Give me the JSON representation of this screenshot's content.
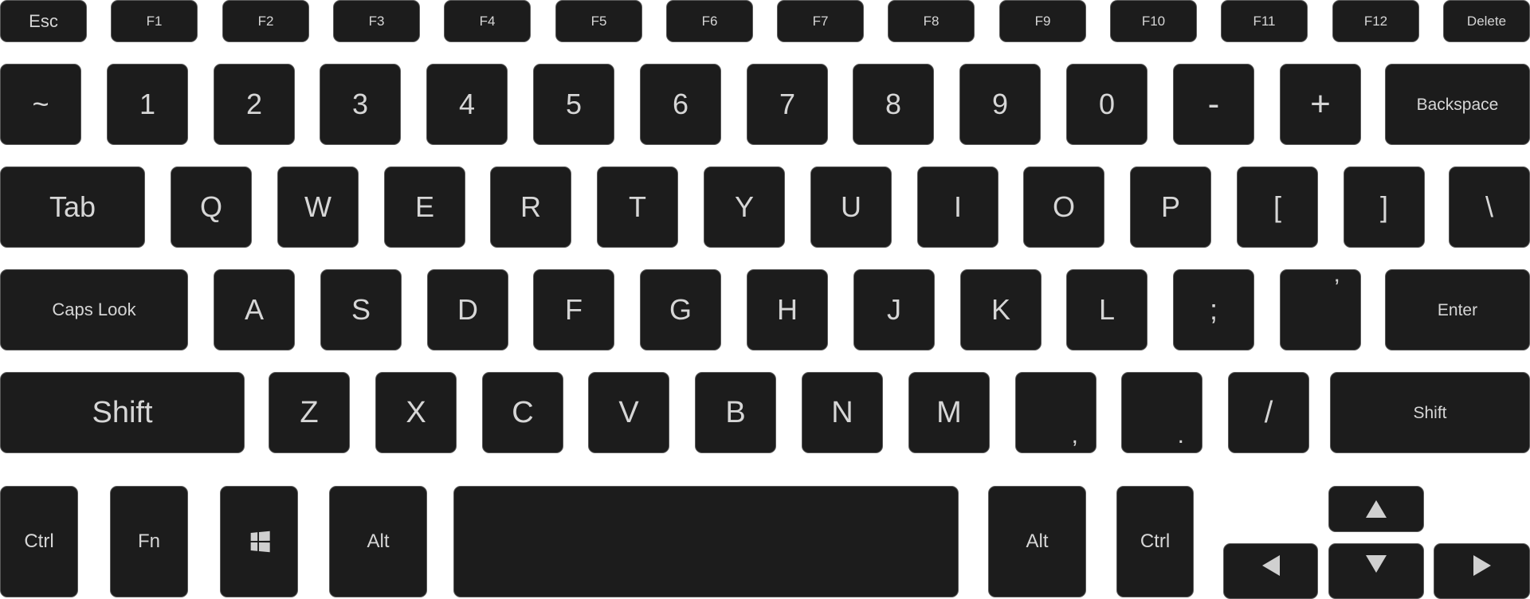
{
  "keyboard": {
    "function_row": [
      "Esc",
      "F1",
      "F2",
      "F3",
      "F4",
      "F5",
      "F6",
      "F7",
      "F8",
      "F9",
      "F10",
      "F11",
      "F12",
      "Delete"
    ],
    "number_row": [
      "~",
      "1",
      "2",
      "3",
      "4",
      "5",
      "6",
      "7",
      "8",
      "9",
      "0",
      "-",
      "+",
      "Backspace"
    ],
    "top_row": [
      "Tab",
      "Q",
      "W",
      "E",
      "R",
      "T",
      "Y",
      "U",
      "I",
      "O",
      "P",
      "[",
      "]",
      "\\"
    ],
    "home_row": [
      "Caps Look",
      "A",
      "S",
      "D",
      "F",
      "G",
      "H",
      "J",
      "K",
      "L",
      ";",
      "’",
      "Enter"
    ],
    "bottom_row": [
      "Shift",
      "Z",
      "X",
      "C",
      "V",
      "B",
      "N",
      "M",
      ",",
      ".",
      "/",
      "Shift"
    ],
    "modifier_row": [
      "Ctrl",
      "Fn",
      "windows-icon",
      "Alt",
      "",
      "Alt",
      "Ctrl"
    ],
    "arrows": [
      "arrow-up-icon",
      "arrow-left-icon",
      "arrow-down-icon",
      "arrow-right-icon"
    ]
  },
  "colors": {
    "key_fill": "#1c1c1c",
    "key_text": "#d6d6d6",
    "background": "#ffffff"
  }
}
